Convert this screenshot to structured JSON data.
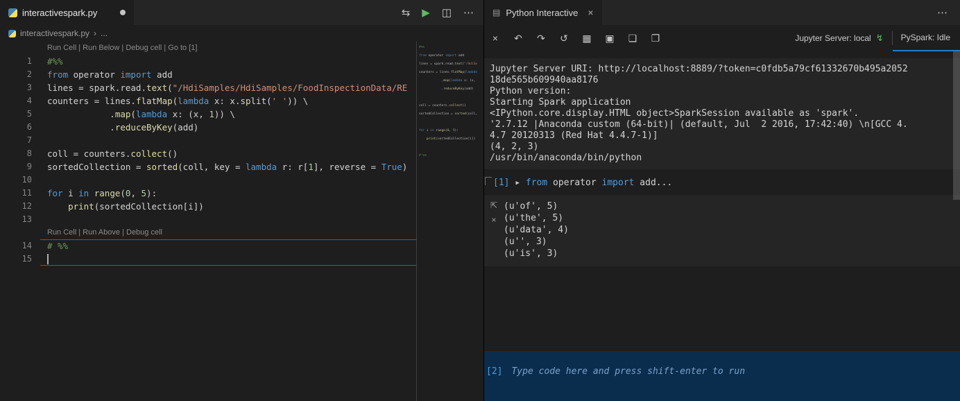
{
  "colors": {
    "bg": "#1e1e1e",
    "surface": "#252526",
    "accent": "#0e70c0",
    "kw": "#569cd6",
    "cm": "#6a9955",
    "str": "#ce9178",
    "num": "#b5cea8",
    "fn": "#dcdcaa",
    "txt": "#d4d4d4",
    "dim": "#858585",
    "inputbg": "#0a2d4e",
    "prompt": "#4f9cd6",
    "ph": "#7ba3c8",
    "icon": "#c5c5c5",
    "green": "#5fb962"
  },
  "editor": {
    "tab_title": "interactivespark.py",
    "breadcrumb_file": "interactivespark.py",
    "breadcrumb_sep": "›",
    "breadcrumb_more": "...",
    "actions": {
      "open_changes_glyph": "⇆",
      "run_glyph": "▶",
      "split_glyph": "◫",
      "more_glyph": "⋯"
    },
    "lines": [
      {
        "n": "1",
        "lens": "Run Cell | Run Below | Debug cell | Go to [1]",
        "tokens": [
          {
            "c": "c",
            "t": "#%%"
          }
        ]
      },
      {
        "n": "2",
        "tokens": [
          {
            "c": "k",
            "t": "from"
          },
          {
            "c": "p",
            "t": " operator "
          },
          {
            "c": "k",
            "t": "import"
          },
          {
            "c": "p",
            "t": " add"
          }
        ]
      },
      {
        "n": "3",
        "tokens": [
          {
            "c": "p",
            "t": "lines = spark.read."
          },
          {
            "c": "f",
            "t": "text"
          },
          {
            "c": "p",
            "t": "("
          },
          {
            "c": "s",
            "t": "\"/HdiSamples/HdiSamples/FoodInspectionData/RE"
          }
        ]
      },
      {
        "n": "4",
        "tokens": [
          {
            "c": "p",
            "t": "counters = lines."
          },
          {
            "c": "f",
            "t": "flatMap"
          },
          {
            "c": "p",
            "t": "("
          },
          {
            "c": "k",
            "t": "lambda"
          },
          {
            "c": "p",
            "t": " x: x."
          },
          {
            "c": "f",
            "t": "split"
          },
          {
            "c": "p",
            "t": "("
          },
          {
            "c": "s",
            "t": "' '"
          },
          {
            "c": "p",
            "t": ")) \\"
          }
        ]
      },
      {
        "n": "5",
        "tokens": [
          {
            "c": "p",
            "t": "            ."
          },
          {
            "c": "f",
            "t": "map"
          },
          {
            "c": "p",
            "t": "("
          },
          {
            "c": "k",
            "t": "lambda"
          },
          {
            "c": "p",
            "t": " x: (x, "
          },
          {
            "c": "n",
            "t": "1"
          },
          {
            "c": "p",
            "t": ")) \\"
          }
        ]
      },
      {
        "n": "6",
        "tokens": [
          {
            "c": "p",
            "t": "            ."
          },
          {
            "c": "f",
            "t": "reduceByKey"
          },
          {
            "c": "p",
            "t": "(add)"
          }
        ]
      },
      {
        "n": "7",
        "tokens": []
      },
      {
        "n": "8",
        "tokens": [
          {
            "c": "p",
            "t": "coll = counters."
          },
          {
            "c": "f",
            "t": "collect"
          },
          {
            "c": "p",
            "t": "()"
          }
        ]
      },
      {
        "n": "9",
        "tokens": [
          {
            "c": "p",
            "t": "sortedCollection = "
          },
          {
            "c": "f",
            "t": "sorted"
          },
          {
            "c": "p",
            "t": "(coll, key = "
          },
          {
            "c": "k",
            "t": "lambda"
          },
          {
            "c": "p",
            "t": " r: r["
          },
          {
            "c": "n",
            "t": "1"
          },
          {
            "c": "p",
            "t": "], reverse = "
          },
          {
            "c": "k",
            "t": "True"
          },
          {
            "c": "p",
            "t": ")"
          }
        ]
      },
      {
        "n": "10",
        "tokens": []
      },
      {
        "n": "11",
        "tokens": [
          {
            "c": "k",
            "t": "for"
          },
          {
            "c": "p",
            "t": " i "
          },
          {
            "c": "k",
            "t": "in"
          },
          {
            "c": "p",
            "t": " "
          },
          {
            "c": "f",
            "t": "range"
          },
          {
            "c": "p",
            "t": "("
          },
          {
            "c": "n",
            "t": "0"
          },
          {
            "c": "p",
            "t": ", "
          },
          {
            "c": "n",
            "t": "5"
          },
          {
            "c": "p",
            "t": "):"
          }
        ]
      },
      {
        "n": "12",
        "tokens": [
          {
            "c": "p",
            "t": "    "
          },
          {
            "c": "f",
            "t": "print"
          },
          {
            "c": "p",
            "t": "(sortedCollection[i])"
          }
        ]
      },
      {
        "n": "13",
        "tokens": []
      },
      {
        "n": "14",
        "lens": "Run Cell | Run Above | Debug cell",
        "cellTop": true,
        "tokens": [
          {
            "c": "c",
            "t": "# %%"
          }
        ]
      },
      {
        "n": "15",
        "cellBottom": true,
        "cursor": true,
        "tokens": []
      }
    ]
  },
  "panel": {
    "tab_label": "Python Interactive",
    "tab_icon_glyph": "▤",
    "tab_close_glyph": "×",
    "more_glyph": "⋯",
    "toolbar": {
      "icons": [
        {
          "name": "clear-all",
          "glyph": "×"
        },
        {
          "name": "undo",
          "glyph": "↶"
        },
        {
          "name": "redo",
          "glyph": "↷"
        },
        {
          "name": "restart-kernel",
          "glyph": "↺"
        },
        {
          "name": "variable-explorer",
          "glyph": "▦"
        },
        {
          "name": "save",
          "glyph": "▣"
        },
        {
          "name": "expand-all",
          "glyph": "❏"
        },
        {
          "name": "collapse-all",
          "glyph": "❐"
        }
      ],
      "jupyter_server_label": "Jupyter Server: local",
      "server_icon_glyph": "↯",
      "kernel_status": "PySpark: Idle"
    },
    "startup_output": [
      "Jupyter Server URI: http://localhost:8889/?token=c0fdb5a79cf61332670b495a2052",
      "18de565b609940aa8176",
      "Python version:",
      "Starting Spark application",
      "<IPython.core.display.HTML object>SparkSession available as 'spark'.",
      "'2.7.12 |Anaconda custom (64-bit)| (default, Jul  2 2016, 17:42:40) \\n[GCC 4.",
      "4.7 20120313 (Red Hat 4.4.7-1)]",
      "(4, 2, 3)",
      "/usr/bin/anaconda/bin/python"
    ],
    "cell": {
      "prompt": "[1]",
      "run_glyph": "▶",
      "code_tokens": [
        {
          "c": "k",
          "t": "from"
        },
        {
          "c": "p",
          "t": " operator "
        },
        {
          "c": "k",
          "t": "import"
        },
        {
          "c": "p",
          "t": " add..."
        }
      ]
    },
    "gutter": {
      "goto_glyph": "⇱",
      "close_glyph": "×"
    },
    "result_lines": [
      "(u'of', 5)",
      "(u'the', 5)",
      "(u'data', 4)",
      "(u'', 3)",
      "(u'is', 3)"
    ],
    "input": {
      "prompt": "[2]",
      "placeholder": "Type code here and press shift-enter to run"
    }
  }
}
